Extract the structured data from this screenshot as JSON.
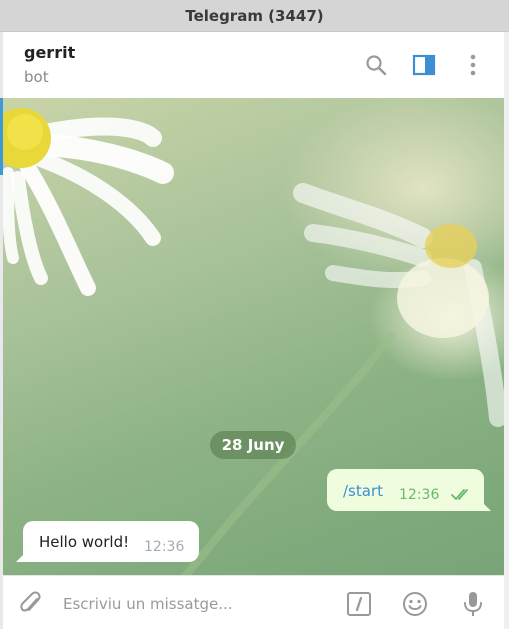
{
  "window": {
    "title": "Telegram (3447)"
  },
  "chat": {
    "name": "gerrit",
    "status": "bot"
  },
  "header_icons": [
    "search-icon",
    "sidebar-toggle-icon",
    "more-vertical-icon"
  ],
  "messages": {
    "date_separator": "28 Juny",
    "outgoing": {
      "text": "/start",
      "time": "12:36",
      "status": "read"
    },
    "incoming": {
      "text": "Hello world!",
      "time": "12:36"
    }
  },
  "composer": {
    "placeholder": "Escriviu un missatge...",
    "icons": [
      "attach-icon",
      "bot-commands-icon",
      "emoji-icon",
      "microphone-icon"
    ]
  },
  "colors": {
    "accent": "#3d9ad5",
    "outgoing_bubble": "#effdde",
    "outgoing_link": "#3d8fd1",
    "outgoing_time": "#6ab86c",
    "incoming_time": "#a0acb6"
  }
}
